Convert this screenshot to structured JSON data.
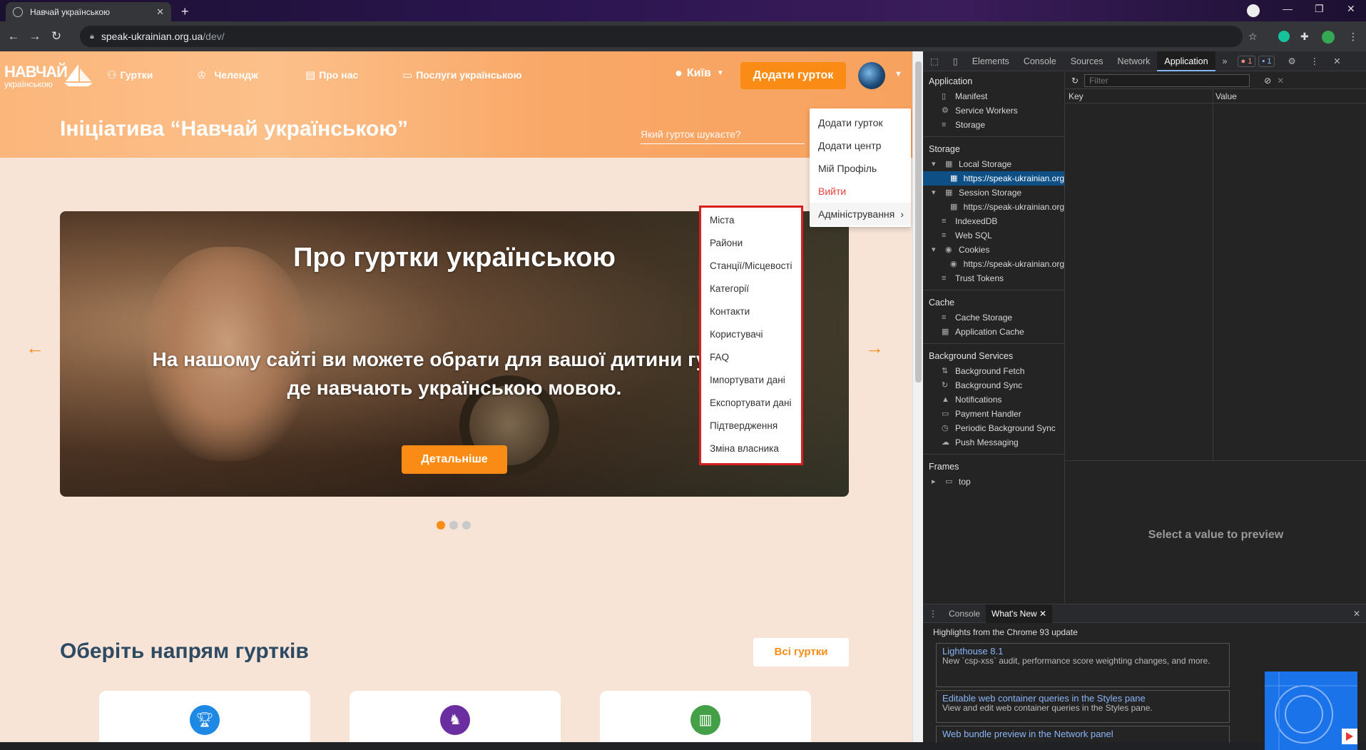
{
  "browser": {
    "tab_title": "Навчай українською",
    "url_host": "speak-ukrainian.org.ua",
    "url_path": "/dev/"
  },
  "site": {
    "logo_main": "НАВЧАЙ",
    "logo_sub": "українською",
    "nav": [
      {
        "label": "Гуртки",
        "icon": "clubs-icon"
      },
      {
        "label": "Челендж",
        "icon": "challenge-icon"
      },
      {
        "label": "Про нас",
        "icon": "about-icon"
      },
      {
        "label": "Послуги українською",
        "icon": "folder-icon"
      }
    ],
    "city": "Київ",
    "add_club_button": "Додати гурток",
    "page_title": "Ініціатива “Навчай українською”",
    "search_placeholder": "Який гурток шукаєте?",
    "slide": {
      "title": "Про гуртки українською",
      "text_line1": "На нашому сайті ви можете обрати для вашої дитини гуртки,",
      "text_line2": "де навчають українською мовою.",
      "button": "Детальніше"
    },
    "section_title": "Оберіть напрям гуртків",
    "all_clubs_button": "Всі гуртки",
    "user_menu": [
      "Додати гурток",
      "Додати центр",
      "Мій Профіль",
      "Вийти",
      "Адміністрування"
    ],
    "admin_menu": [
      "Міста",
      "Райони",
      "Станції/Місцевості",
      "Категорії",
      "Контакти",
      "Користувачі",
      "FAQ",
      "Імпортувати дані",
      "Експортувати дані",
      "Підтвердження",
      "Зміна власника"
    ],
    "colors": {
      "accent": "#fa8c16",
      "title": "#2d4a63",
      "highlight_border": "#d81e1e"
    }
  },
  "devtools": {
    "tabs": [
      "Elements",
      "Console",
      "Sources",
      "Network",
      "Application"
    ],
    "active_tab": "Application",
    "error_count": "1",
    "message_count": "1",
    "sidebar": {
      "application_head": "Application",
      "application_items": [
        "Manifest",
        "Service Workers",
        "Storage"
      ],
      "storage_head": "Storage",
      "local_storage": "Local Storage",
      "local_origin": "https://speak-ukrainian.org",
      "session_storage": "Session Storage",
      "session_origin": "https://speak-ukrainian.org",
      "indexeddb": "IndexedDB",
      "websql": "Web SQL",
      "cookies": "Cookies",
      "cookies_origin": "https://speak-ukrainian.org",
      "trust_tokens": "Trust Tokens",
      "cache_head": "Cache",
      "cache_items": [
        "Cache Storage",
        "Application Cache"
      ],
      "bg_head": "Background Services",
      "bg_items": [
        "Background Fetch",
        "Background Sync",
        "Notifications",
        "Payment Handler",
        "Periodic Background Sync",
        "Push Messaging"
      ],
      "frames_head": "Frames",
      "frames_top": "top"
    },
    "filter_placeholder": "Filter",
    "col_key": "Key",
    "col_value": "Value",
    "preview_text": "Select a value to preview",
    "drawer": {
      "tabs": [
        "Console",
        "What's New"
      ],
      "headline": "Highlights from the Chrome 93 update",
      "cards": [
        {
          "title": "Lighthouse 8.1",
          "desc": "New `csp-xss` audit, performance score weighting changes, and more."
        },
        {
          "title": "Editable web container queries in the Styles pane",
          "desc": "View and edit web container queries in the Styles pane."
        },
        {
          "title": "Web bundle preview in the Network panel",
          "desc": ""
        }
      ]
    }
  }
}
